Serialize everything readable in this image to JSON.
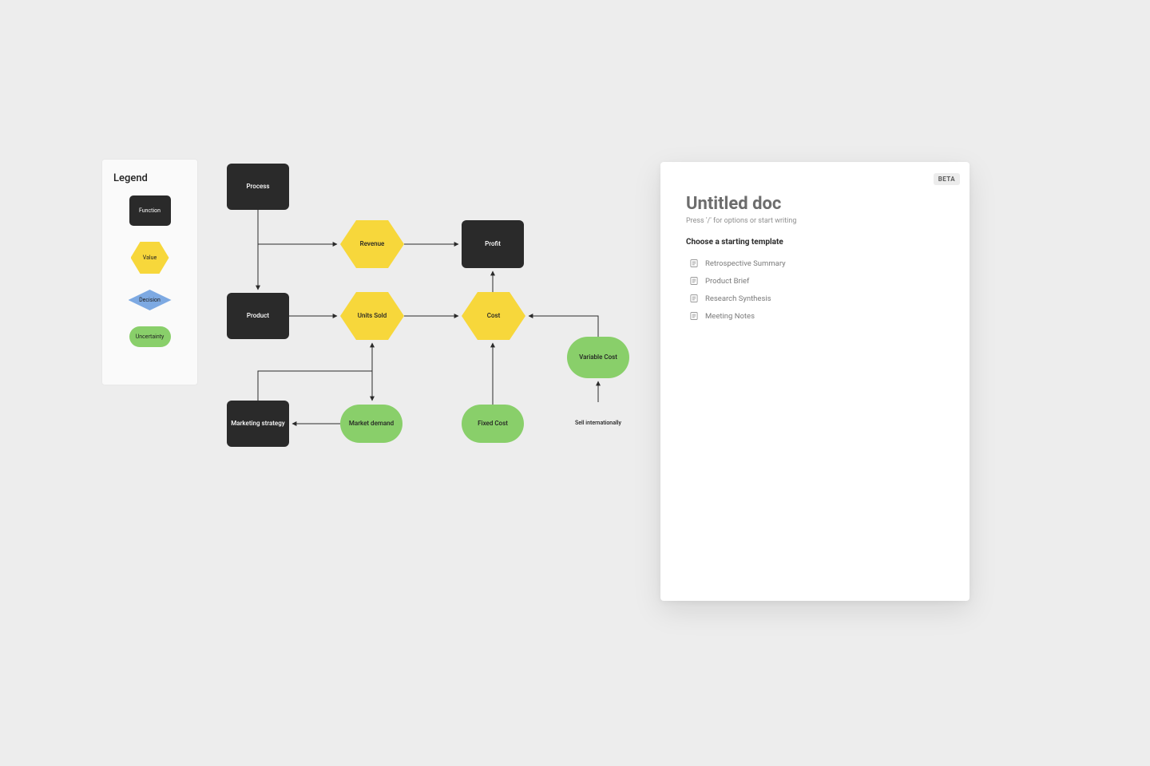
{
  "legend": {
    "title": "Legend",
    "items": {
      "function": "Function",
      "value": "Value",
      "decision": "Decision",
      "uncertainty": "Uncertainty"
    }
  },
  "diagram": {
    "nodes": {
      "process": {
        "label": "Process",
        "type": "function"
      },
      "revenue": {
        "label": "Revenue",
        "type": "value"
      },
      "profit": {
        "label": "Profit",
        "type": "function"
      },
      "product": {
        "label": "Product",
        "type": "function"
      },
      "unitsSold": {
        "label": "Units Sold",
        "type": "value"
      },
      "cost": {
        "label": "Cost",
        "type": "value"
      },
      "variable": {
        "label": "Variable Cost",
        "type": "uncertainty"
      },
      "marketing": {
        "label": "Marketing strategy",
        "type": "function"
      },
      "demand": {
        "label": "Market demand",
        "type": "uncertainty"
      },
      "fixed": {
        "label": "Fixed Cost",
        "type": "uncertainty"
      },
      "sellIntl": {
        "label": "Sell internationally",
        "type": "decision"
      }
    },
    "edges": [
      {
        "from": "process",
        "to": "revenue"
      },
      {
        "from": "process",
        "to": "product"
      },
      {
        "from": "revenue",
        "to": "profit"
      },
      {
        "from": "product",
        "to": "unitsSold"
      },
      {
        "from": "unitsSold",
        "to": "cost"
      },
      {
        "from": "cost",
        "to": "profit"
      },
      {
        "from": "variable",
        "to": "cost"
      },
      {
        "from": "sellIntl",
        "to": "variable"
      },
      {
        "from": "fixed",
        "to": "cost"
      },
      {
        "from": "demand",
        "to": "marketing"
      },
      {
        "from": "marketing",
        "to": "unitsSold"
      },
      {
        "from": "unitsSold",
        "to": "demand"
      }
    ]
  },
  "doc_panel": {
    "badge": "BETA",
    "title": "Untitled doc",
    "hint": "Press '/' for options or start writing",
    "template_heading": "Choose a starting template",
    "templates": [
      {
        "label": "Retrospective Summary"
      },
      {
        "label": "Product Brief"
      },
      {
        "label": "Research Synthesis"
      },
      {
        "label": "Meeting Notes"
      }
    ]
  }
}
